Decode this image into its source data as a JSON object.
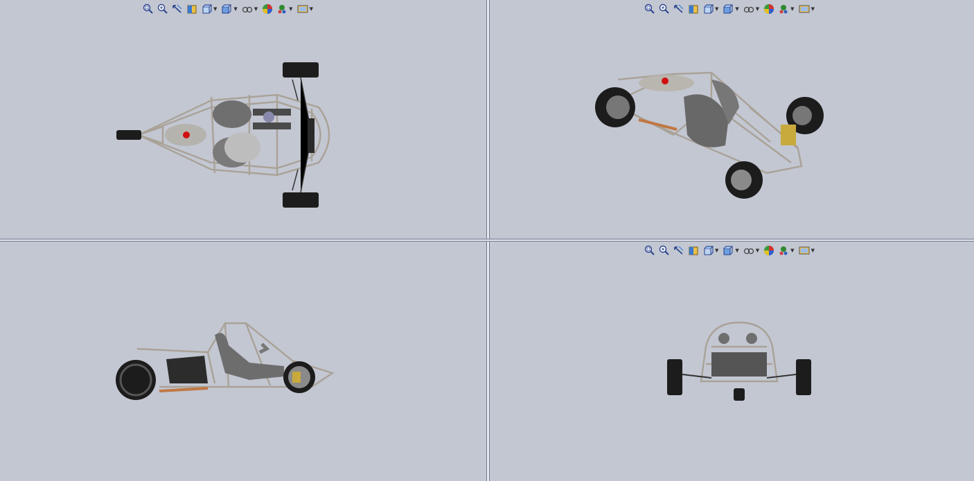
{
  "app": "CAD four-view model window",
  "viewports": [
    {
      "id": "top-left",
      "view": "top"
    },
    {
      "id": "top-right",
      "view": "isometric"
    },
    {
      "id": "bottom-left",
      "view": "right-side"
    },
    {
      "id": "bottom-right",
      "view": "front"
    }
  ],
  "heads_up_toolbar": {
    "tools": [
      {
        "icon": "zoom-to-fit-icon",
        "dropdown": false
      },
      {
        "icon": "zoom-to-area-icon",
        "dropdown": false
      },
      {
        "icon": "previous-view-icon",
        "dropdown": false
      },
      {
        "icon": "section-view-icon",
        "dropdown": false
      },
      {
        "icon": "view-orientation-icon",
        "dropdown": true
      },
      {
        "icon": "display-style-icon",
        "dropdown": true
      },
      {
        "icon": "hide-show-items-icon",
        "dropdown": true
      },
      {
        "icon": "edit-appearance-icon",
        "dropdown": false
      },
      {
        "icon": "apply-scene-icon",
        "dropdown": true
      },
      {
        "icon": "view-settings-icon",
        "dropdown": true
      }
    ]
  },
  "colors": {
    "background": "#c3c7d2",
    "frame_tube": "#b8b2a8",
    "tire": "#1c1c1c",
    "accent_red": "#d01010",
    "exhaust": "#c07845"
  }
}
